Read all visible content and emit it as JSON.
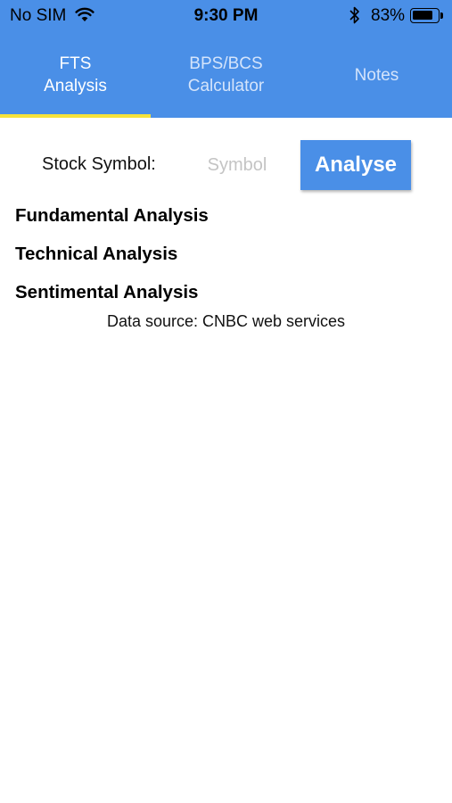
{
  "status_bar": {
    "carrier": "No SIM",
    "time": "9:30 PM",
    "battery_percent": "83%",
    "battery_level": 0.83
  },
  "tabs": [
    {
      "label": "FTS\nAnalysis",
      "active": true
    },
    {
      "label": "BPS/BCS\nCalculator",
      "active": false
    },
    {
      "label": "Notes",
      "active": false
    }
  ],
  "colors": {
    "header_blue": "#4a8fe7",
    "active_tab_indicator": "#f6e33b",
    "button_blue": "#4a8fe7"
  },
  "form": {
    "stock_label": "Stock Symbol:",
    "symbol_value": "",
    "symbol_placeholder": "Symbol",
    "analyse_label": "Analyse"
  },
  "sections": [
    {
      "label": "Fundamental Analysis"
    },
    {
      "label": "Technical Analysis"
    },
    {
      "label": "Sentimental Analysis"
    }
  ],
  "data_source": "Data source: CNBC web services"
}
